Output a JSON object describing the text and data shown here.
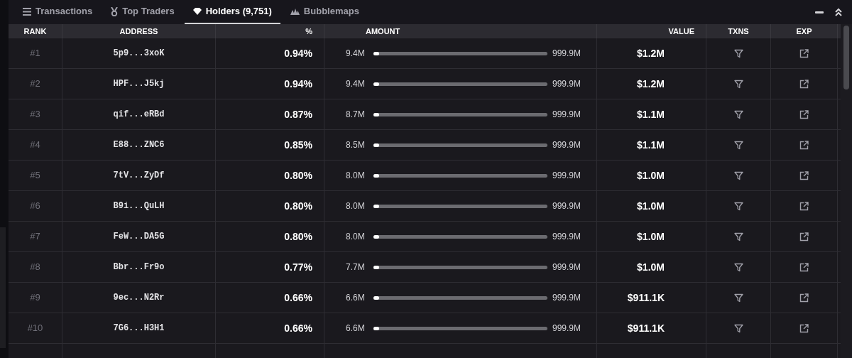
{
  "tabs": [
    {
      "label": "Transactions",
      "kind": "list",
      "selected": false
    },
    {
      "label": "Top Traders",
      "kind": "medal",
      "selected": false
    },
    {
      "label": "Holders (9,751)",
      "kind": "diamond",
      "selected": true
    },
    {
      "label": "Bubblemaps",
      "kind": "bubbles",
      "selected": false
    }
  ],
  "table": {
    "columns": [
      "RANK",
      "ADDRESS",
      "%",
      "AMOUNT",
      "VALUE",
      "TXNS",
      "EXP"
    ],
    "rows": [
      {
        "rank": "#1",
        "address": "5p9...3xoK",
        "percent": "0.94%",
        "amount": "9.4M",
        "level": 0.0094,
        "total": "999.9M",
        "value": "$1.2M"
      },
      {
        "rank": "#2",
        "address": "HPF...J5kj",
        "percent": "0.94%",
        "amount": "9.4M",
        "level": 0.0094,
        "total": "999.9M",
        "value": "$1.2M"
      },
      {
        "rank": "#3",
        "address": "qif...eRBd",
        "percent": "0.87%",
        "amount": "8.7M",
        "level": 0.0087,
        "total": "999.9M",
        "value": "$1.1M"
      },
      {
        "rank": "#4",
        "address": "E88...ZNC6",
        "percent": "0.85%",
        "amount": "8.5M",
        "level": 0.0085,
        "total": "999.9M",
        "value": "$1.1M"
      },
      {
        "rank": "#5",
        "address": "7tV...ZyDf",
        "percent": "0.80%",
        "amount": "8.0M",
        "level": 0.008,
        "total": "999.9M",
        "value": "$1.0M"
      },
      {
        "rank": "#6",
        "address": "B9i...QuLH",
        "percent": "0.80%",
        "amount": "8.0M",
        "level": 0.008,
        "total": "999.9M",
        "value": "$1.0M"
      },
      {
        "rank": "#7",
        "address": "FeW...DA5G",
        "percent": "0.80%",
        "amount": "8.0M",
        "level": 0.008,
        "total": "999.9M",
        "value": "$1.0M"
      },
      {
        "rank": "#8",
        "address": "Bbr...Fr9o",
        "percent": "0.77%",
        "amount": "7.7M",
        "level": 0.0077,
        "total": "999.9M",
        "value": "$1.0M"
      },
      {
        "rank": "#9",
        "address": "9ec...N2Rr",
        "percent": "0.66%",
        "amount": "6.6M",
        "level": 0.0066,
        "total": "999.9M",
        "value": "$911.1K"
      },
      {
        "rank": "#10",
        "address": "7G6...H3H1",
        "percent": "0.66%",
        "amount": "6.6M",
        "level": 0.0066,
        "total": "999.9M",
        "value": "$911.1K"
      }
    ]
  }
}
